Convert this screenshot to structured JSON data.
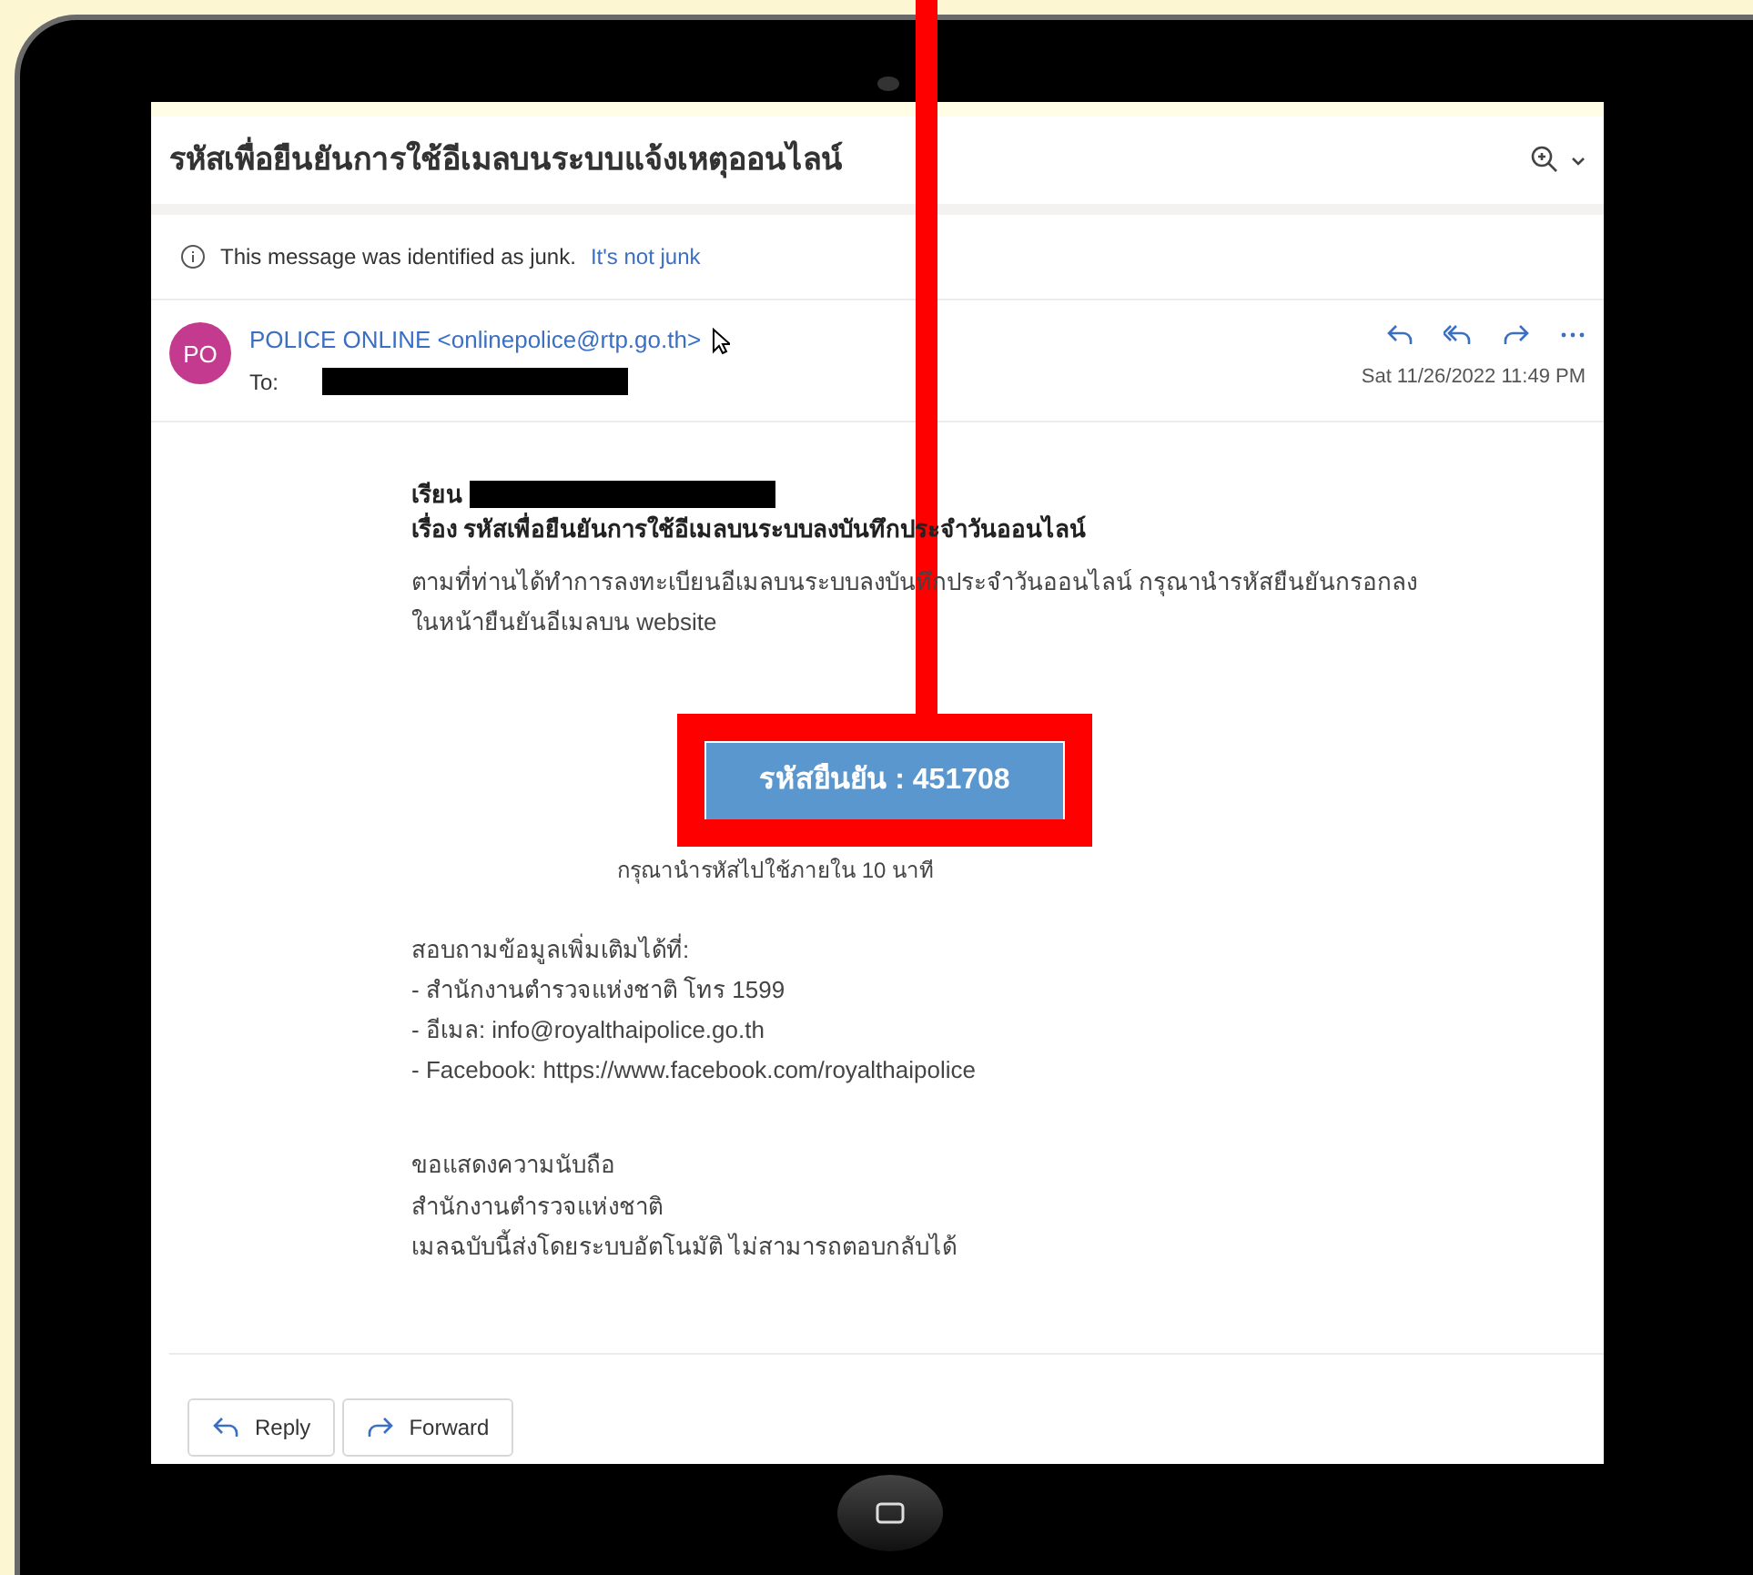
{
  "subject": "รหัสเพื่อยืนยันการใช้อีเมลบนระบบแจ้งเหตุออนไลน์",
  "junk_notice": {
    "text": "This message was identified as junk.",
    "link": "It's not junk"
  },
  "sender": {
    "initials": "PO",
    "name": "POLICE ONLINE <onlinepolice@rtp.go.th>",
    "to_label": "To:",
    "date": "Sat 11/26/2022 11:49 PM"
  },
  "body": {
    "greeting": "เรียน",
    "subject_line": "เรื่อง รหัสเพื่อยืนยันการใช้อีเมลบนระบบลงบันทึกประจำวันออนไลน์",
    "paragraph": "ตามที่ท่านได้ทำการลงทะเบียนอีเมลบนระบบลงบันทึกประจำวันออนไลน์ กรุณานำรหัสยืนยันกรอกลงในหน้ายืนยันอีเมลบน website",
    "code_button": "รหัสยืนยัน : 451708",
    "code_note": "กรุณานำรหัสไปใช้ภายใน 10 นาที",
    "contact_heading": "สอบถามข้อมูลเพิ่มเติมได้ที่:",
    "contact_lines": [
      "- สำนักงานตำรวจแห่งชาติ โทร 1599",
      "- อีเมล: info@royalthaipolice.go.th",
      "- Facebook: https://www.facebook.com/royalthaipolice"
    ],
    "closing_lines": [
      "ขอแสดงความนับถือ",
      "สำนักงานตำรวจแห่งชาติ",
      "เมลฉบับนี้ส่งโดยระบบอัตโนมัติ ไม่สามารถตอบกลับได้"
    ]
  },
  "buttons": [
    {
      "label": "Reply",
      "kind": "reply"
    },
    {
      "label": "Forward",
      "kind": "forward"
    }
  ]
}
